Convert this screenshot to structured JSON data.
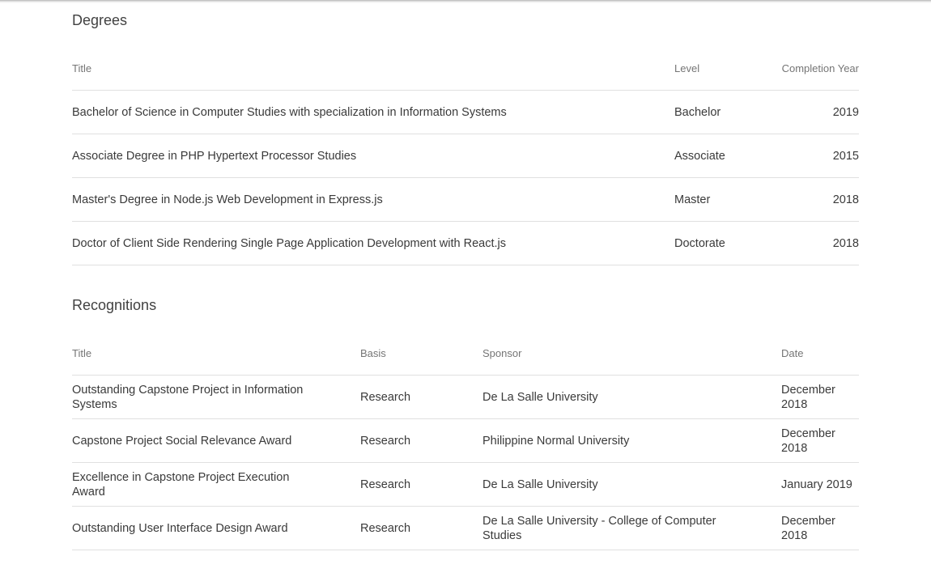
{
  "degrees": {
    "heading": "Degrees",
    "columns": {
      "title": "Title",
      "level": "Level",
      "year": "Completion Year"
    },
    "rows": [
      {
        "title": "Bachelor of Science in Computer Studies with specialization in Information Systems",
        "level": "Bachelor",
        "year": "2019"
      },
      {
        "title": "Associate Degree in PHP Hypertext Processor Studies",
        "level": "Associate",
        "year": "2015"
      },
      {
        "title": "Master's Degree in Node.js Web Development in Express.js",
        "level": "Master",
        "year": "2018"
      },
      {
        "title": "Doctor of Client Side Rendering Single Page Application Development with React.js",
        "level": "Doctorate",
        "year": "2018"
      }
    ]
  },
  "recognitions": {
    "heading": "Recognitions",
    "columns": {
      "title": "Title",
      "basis": "Basis",
      "sponsor": "Sponsor",
      "date": "Date"
    },
    "rows": [
      {
        "title": "Outstanding Capstone Project in Information Systems",
        "basis": "Research",
        "sponsor": "De La Salle University",
        "date": "December 2018"
      },
      {
        "title": "Capstone Project Social Relevance Award",
        "basis": "Research",
        "sponsor": "Philippine Normal University",
        "date": "December 2018"
      },
      {
        "title": "Excellence in Capstone Project Execution Award",
        "basis": "Research",
        "sponsor": "De La Salle University",
        "date": "January 2019"
      },
      {
        "title": "Outstanding User Interface Design Award",
        "basis": "Research",
        "sponsor": "De La Salle University - College of Computer Studies",
        "date": "December 2018"
      }
    ]
  }
}
